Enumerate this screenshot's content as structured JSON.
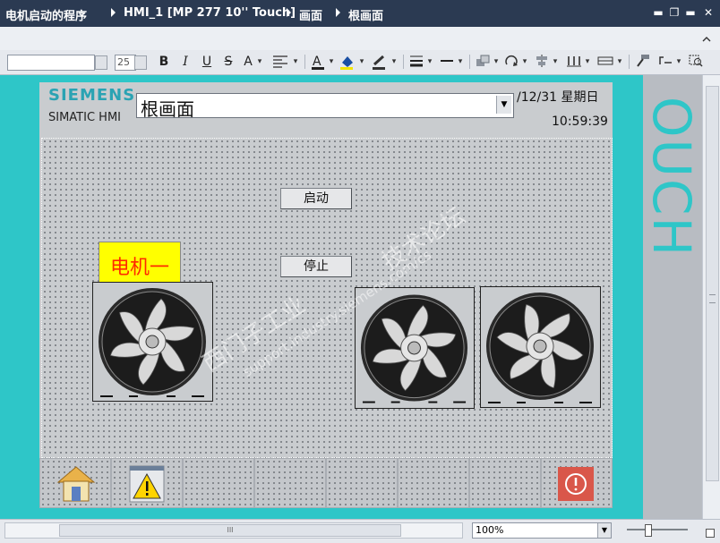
{
  "titlebar": {
    "project": "电机启动的程序",
    "device": "HMI_1 [MP 277 10'' Touch]",
    "folder": "画面",
    "screen": "根画面",
    "buttons": {
      "min": "▬",
      "restore": "❐",
      "close": "✕",
      "float": "▬"
    }
  },
  "toolbar": {
    "font_name": "",
    "font_size": "25",
    "bold": "B",
    "italic": "I",
    "underline": "U",
    "strike": "S",
    "fontsize_up": "A"
  },
  "hmi": {
    "logo": "SIEMENS",
    "product": "SIMATIC HMI",
    "screen_selector": "根画面",
    "date": "/12/31 星期日",
    "time": "10:59:39",
    "motor_label": "电机一",
    "start_button": "启动",
    "stop_button": "停止",
    "side_text": "OUCH"
  },
  "bottombar": {
    "zoom": "100%",
    "scroll_grip": "III"
  },
  "watermark": {
    "line1": "西门子工业",
    "line2": "技术论坛",
    "line3": "support.industry.siemens.com/cs"
  },
  "colors": {
    "titlebar": "#2b3a52",
    "canvas": "#2ec6c8",
    "logo": "#2aa3b3",
    "motor_bg": "#ffff00",
    "motor_text": "#ff2a00"
  }
}
